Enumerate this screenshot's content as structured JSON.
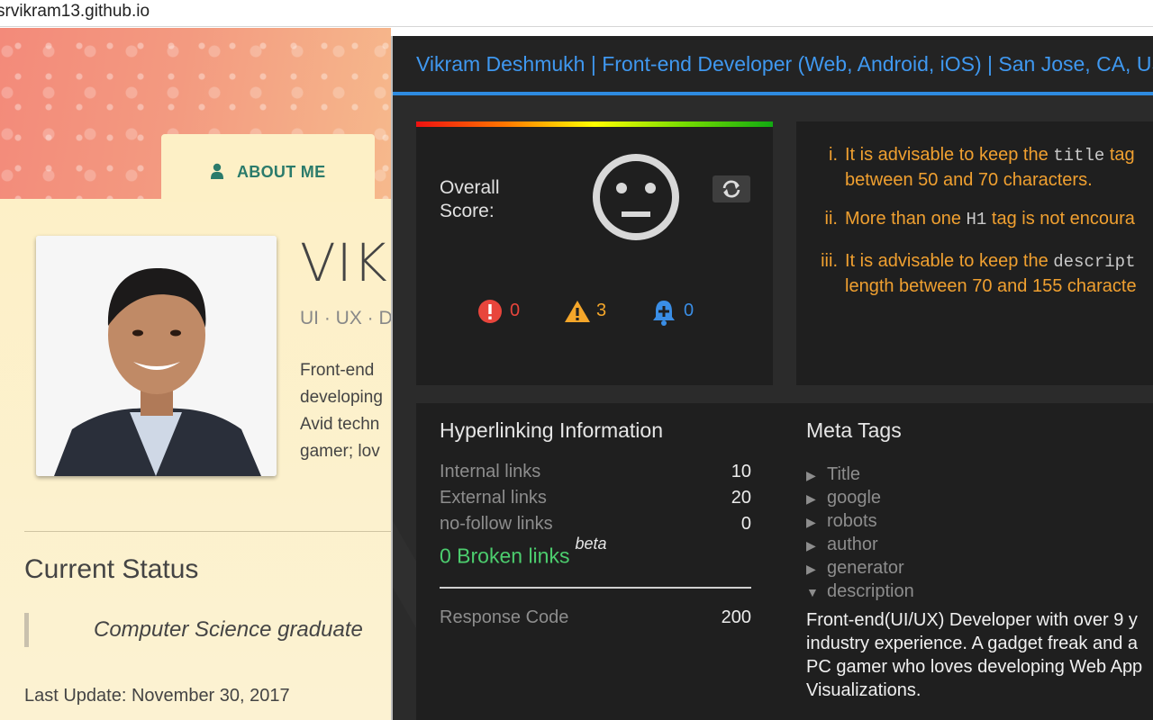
{
  "browser": {
    "url": "srvikram13.github.io"
  },
  "site": {
    "about_tab": "ABOUT ME",
    "name_partial": "VIKR",
    "tagline_partial": "UI · UX · D",
    "bio_lines": [
      "Front-end",
      "developing",
      "Avid techn",
      "gamer; lov"
    ],
    "current_status_heading": "Current Status",
    "status_quote": "Computer Science graduate",
    "last_update": "Last Update: November 30, 2017"
  },
  "panel": {
    "title": "Vikram Deshmukh | Front-end Developer (Web, Android, iOS) | San Jose, CA, USA",
    "score": {
      "label": "Overall Score:",
      "face": "neutral-face-icon",
      "errors": "0",
      "warnings": "3",
      "notices": "0",
      "colors": {
        "error": "#e8453c",
        "warning": "#f4a62a",
        "notice": "#3a8ee6"
      }
    },
    "issues": [
      {
        "num": "i.",
        "pre": "It is advisable to keep the ",
        "code": "title",
        "post": " tag",
        "line2": "between 50 and 70 characters."
      },
      {
        "num": "ii.",
        "pre": "More than one ",
        "code": "H1",
        "post": " tag is not encoura",
        "line2": ""
      },
      {
        "num": "iii.",
        "pre": "It is advisable to keep the ",
        "code": "descript",
        "post": "",
        "line2": "length between 70 and 155 characte"
      }
    ],
    "hyperlinks": {
      "heading": "Hyperlinking Information",
      "rows": [
        {
          "label": "Internal links",
          "value": "10"
        },
        {
          "label": "External links",
          "value": "20"
        },
        {
          "label": "no-follow links",
          "value": "0"
        }
      ],
      "broken": "0 Broken links",
      "beta": "beta",
      "response_label": "Response Code",
      "response_value": "200"
    },
    "meta_tags": {
      "heading": "Meta Tags",
      "items": [
        "Title",
        "google",
        "robots",
        "author",
        "generator",
        "description"
      ],
      "description_text": "Front-end(UI/UX) Developer with over 9 y industry experience. A gadget freak and a PC gamer who loves developing Web App Visualizations."
    }
  }
}
